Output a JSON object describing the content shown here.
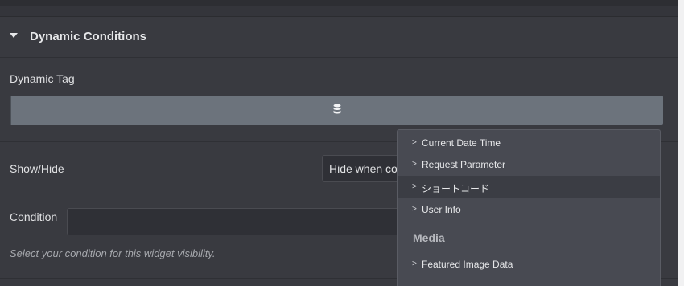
{
  "section": {
    "title": "Dynamic Conditions"
  },
  "dynamic_tag": {
    "label": "Dynamic Tag",
    "button_icon": "database-icon"
  },
  "show_hide": {
    "label": "Show/Hide",
    "selected": "Hide when condition met"
  },
  "condition": {
    "label": "Condition",
    "value": "",
    "help": "Select your condition for this widget visibility."
  },
  "dropdown": {
    "items": [
      {
        "label": "Current Date Time"
      },
      {
        "label": "Request Parameter"
      },
      {
        "label": "ショートコード"
      },
      {
        "label": "User Info"
      }
    ],
    "group": "Media",
    "group_items": [
      {
        "label": "Featured Image Data"
      }
    ],
    "chevron": ">"
  },
  "colors": {
    "background": "#393a40",
    "button": "#6c737c",
    "dropdown": "#484a52"
  }
}
